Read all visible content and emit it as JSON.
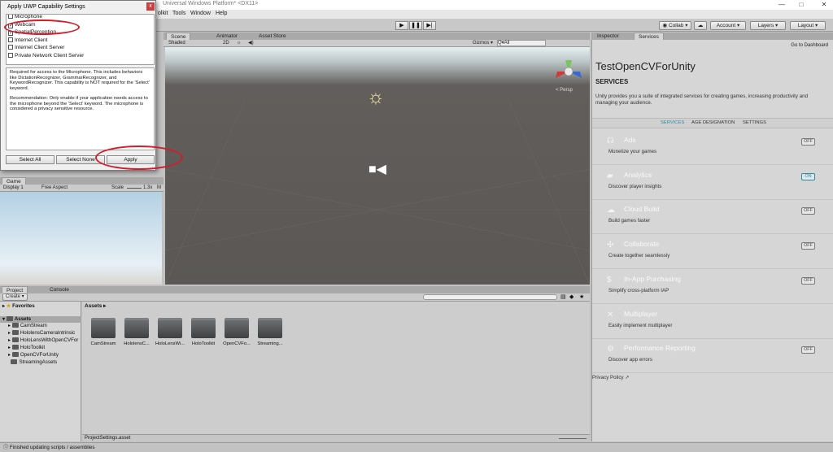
{
  "window": {
    "title": "Universal Windows Platform* <DX11>",
    "min": "—",
    "max": "□",
    "close": "✕"
  },
  "menu": [
    "olkit",
    "Tools",
    "Window",
    "Help"
  ],
  "toolbar": {
    "play": "▶",
    "pause": "❚❚",
    "step": "▶|",
    "collab": "◉ Collab ▾",
    "cloud": "☁",
    "account": "Account ▾",
    "layers": "Layers ▾",
    "layout": "Layout ▾"
  },
  "dialog": {
    "title": "Apply UWP Capability Settings",
    "close": "x",
    "capabilities": [
      {
        "label": "Microphone",
        "checked": false
      },
      {
        "label": "Webcam",
        "checked": true
      },
      {
        "label": "SpatialPerception",
        "checked": true
      },
      {
        "label": "Internet Client",
        "checked": false
      },
      {
        "label": "Internet Client Server",
        "checked": false
      },
      {
        "label": "Private Network Client Server",
        "checked": false
      }
    ],
    "desc1": "Required for access to the Microphone. This includes behaviors like DictationRecognizer, GrammarRecognizer, and KeywordRecognizer. This capability is NOT required for the 'Select' keyword.",
    "desc2": "Recommendation: Only enable if your application needs access to the microphone beyond the 'Select' keyword. The microphone is considered a privacy sensitive resource.",
    "select_all": "Select All",
    "select_none": "Select None",
    "apply": "Apply"
  },
  "scene": {
    "tabs": [
      "Scene",
      "Animator",
      "Asset Store"
    ],
    "shading": "Shaded",
    "mode2d": "2D",
    "gizmos": "Gizmos ▾",
    "search": "Q▾All",
    "persp": "< Persp"
  },
  "game": {
    "tab": "Game",
    "display": "Display 1",
    "aspect": "Free Aspect",
    "scale": "Scale",
    "scale_val": "1.3x",
    "m": "M"
  },
  "project": {
    "tabs": [
      "Project",
      "Console"
    ],
    "create": "Create ▾",
    "favorites": "Favorites",
    "assets_root": "Assets",
    "tree": [
      "CamStream",
      "HololensCameraIntrinsic",
      "HoloLensWithOpenCVFor",
      "HoloToolkit",
      "OpenCVForUnity",
      "StreamingAssets"
    ],
    "breadcrumb": "Assets ▸",
    "assets": [
      "CamStream",
      "HololensC...",
      "HoloLensWi...",
      "HoloToolkit",
      "OpenCVFo...",
      "Streaming..."
    ],
    "footer": "ProjectSettings.asset"
  },
  "status": "Finished updating scripts / assemblies",
  "right": {
    "tabs": [
      "Inspector",
      "Services"
    ],
    "dashboard": "Go to Dashboard",
    "title": "TestOpenCVForUnity",
    "subtitle": "SERVICES",
    "desc": "Unity provides you a suite of integrated services for creating games, increasing productivity and managing your audience.",
    "nav": [
      "SERVICES",
      "AGE DESIGNATION",
      "SETTINGS"
    ],
    "services": [
      {
        "name": "Ads",
        "desc": "Monetize your games",
        "toggle": "OFF",
        "on": false,
        "icon": "☊"
      },
      {
        "name": "Analytics",
        "desc": "Discover player insights",
        "toggle": "ON",
        "on": true,
        "icon": "▰"
      },
      {
        "name": "Cloud Build",
        "desc": "Build games faster",
        "toggle": "OFF",
        "on": false,
        "icon": "☁"
      },
      {
        "name": "Collaborate",
        "desc": "Create together seamlessly",
        "toggle": "OFF",
        "on": false,
        "icon": "✣"
      },
      {
        "name": "In-App Purchasing",
        "desc": "Simplify cross-platform IAP",
        "toggle": "OFF",
        "on": false,
        "icon": "$"
      },
      {
        "name": "Multiplayer",
        "desc": "Easily implement multiplayer",
        "toggle": "",
        "on": false,
        "icon": "✕"
      },
      {
        "name": "Performance Reporting",
        "desc": "Discover app errors",
        "toggle": "OFF",
        "on": false,
        "icon": "⚙"
      }
    ],
    "privacy": "Privacy Policy ↗"
  }
}
